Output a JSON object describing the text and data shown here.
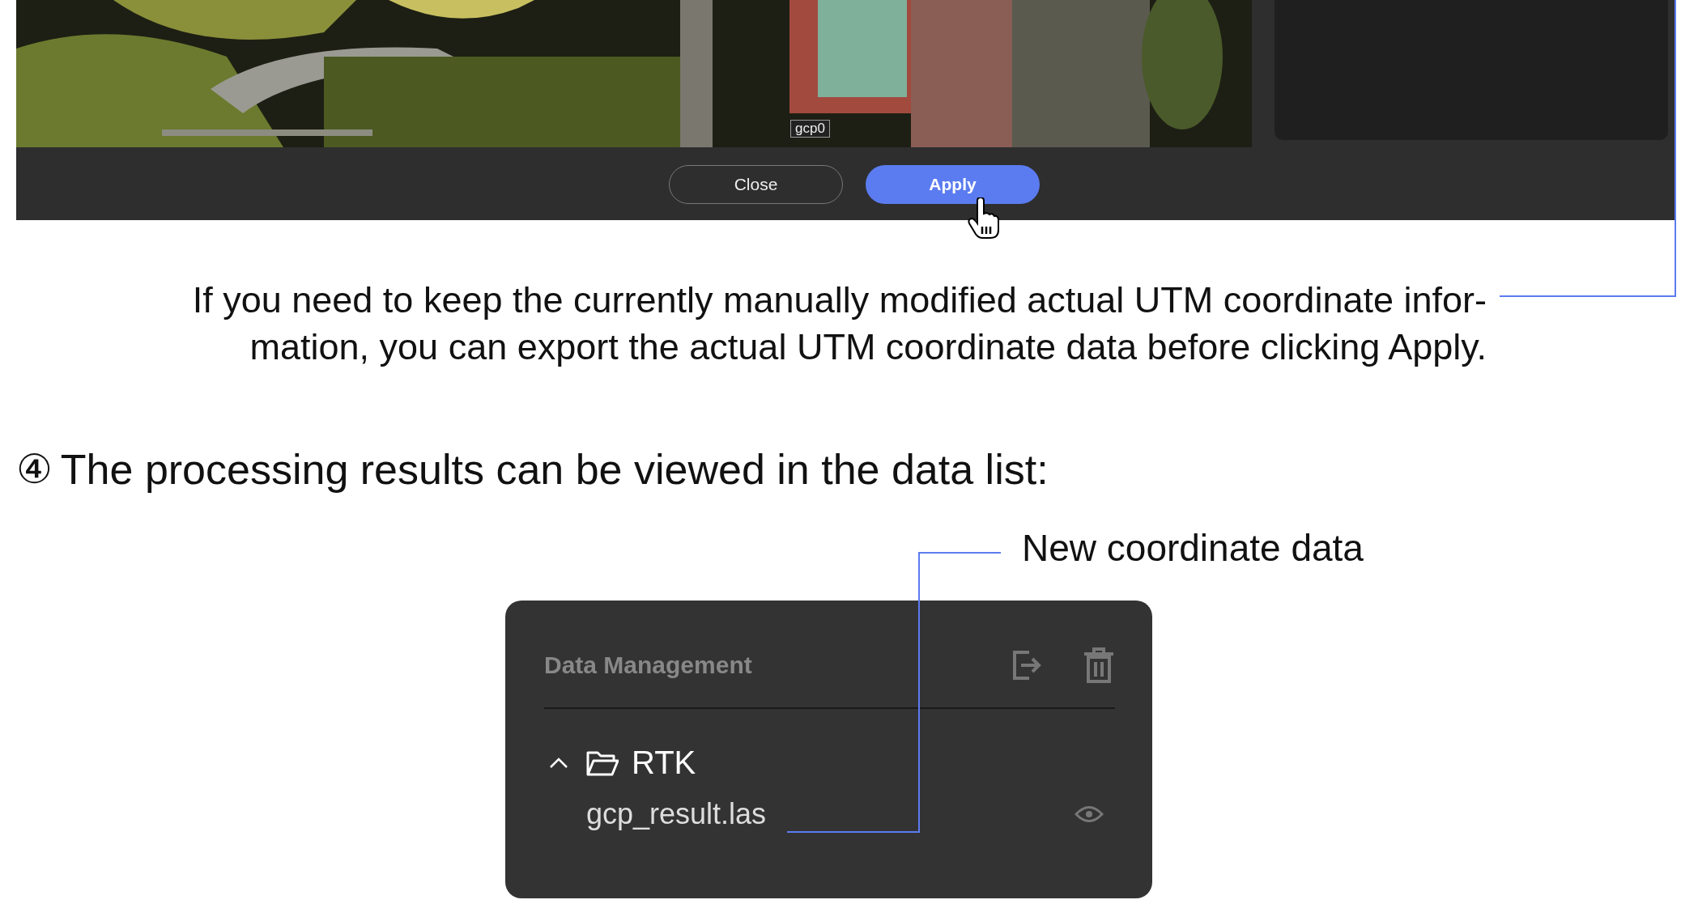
{
  "screenshot": {
    "marker_label": "gcp0",
    "buttons": [
      {
        "label": "Close",
        "kind": "secondary"
      },
      {
        "label": "Apply",
        "kind": "primary"
      }
    ]
  },
  "note": {
    "lines": [
      "If you need to keep the currently manually modified actual UTM coordinate infor-",
      "mation, you can export the actual UTM coordinate data before clicking Apply."
    ]
  },
  "step": {
    "number": "④",
    "text": "The processing results can be viewed in the data list:"
  },
  "callout": "New coordinate data",
  "panel": {
    "title": "Data Management",
    "tree": [
      {
        "label": "RTK",
        "expanded": true,
        "children": [
          {
            "label": "gcp_result.las",
            "visible": true
          }
        ]
      }
    ]
  }
}
